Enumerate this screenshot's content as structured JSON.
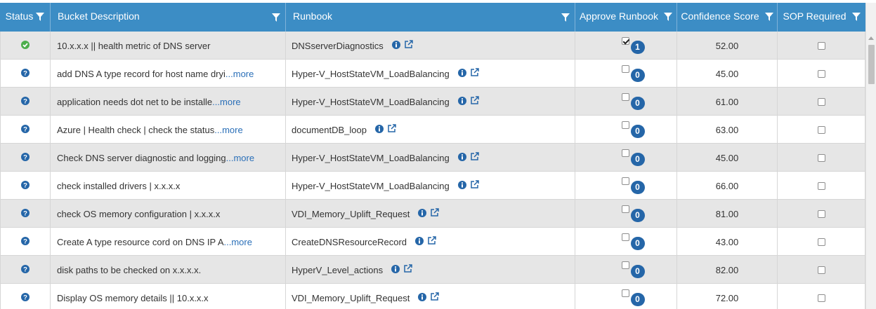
{
  "columns": {
    "status": "Status",
    "bucket": "Bucket Description",
    "runbook": "Runbook",
    "approve": "Approve Runbook",
    "confidence": "Confidence Score",
    "sop": "SOP Required"
  },
  "colors": {
    "header": "#3c8dc5",
    "ok": "#4cae4c",
    "info": "#2566a8",
    "link": "#2a6fb8",
    "row_alt": "#e6e6e6"
  },
  "rows": [
    {
      "status_icon": "check-circle-icon",
      "desc": "10.x.x.x || health metric of DNS server",
      "more": "",
      "runbook": "DNSserverDiagnostics",
      "approved": true,
      "count": "1",
      "score": "52.00",
      "sop": false
    },
    {
      "status_icon": "question-circle-icon",
      "desc": "add DNS A type record for host name dryi",
      "more": "...more",
      "runbook": "Hyper-V_HostStateVM_LoadBalancing",
      "approved": false,
      "count": "0",
      "score": "45.00",
      "sop": false
    },
    {
      "status_icon": "question-circle-icon",
      "desc": "application needs dot net to be installe",
      "more": "...more",
      "runbook": "Hyper-V_HostStateVM_LoadBalancing",
      "approved": false,
      "count": "0",
      "score": "61.00",
      "sop": false
    },
    {
      "status_icon": "question-circle-icon",
      "desc": "Azure | Health check | check the status ",
      "more": "...more",
      "runbook": "documentDB_loop",
      "approved": false,
      "count": "0",
      "score": "63.00",
      "sop": false
    },
    {
      "status_icon": "question-circle-icon",
      "desc": "Check DNS server diagnostic and logging ",
      "more": "...more",
      "runbook": "Hyper-V_HostStateVM_LoadBalancing",
      "approved": false,
      "count": "0",
      "score": "45.00",
      "sop": false
    },
    {
      "status_icon": "question-circle-icon",
      "desc": "check installed drivers | x.x.x.x",
      "more": "",
      "runbook": "Hyper-V_HostStateVM_LoadBalancing",
      "approved": false,
      "count": "0",
      "score": "66.00",
      "sop": false
    },
    {
      "status_icon": "question-circle-icon",
      "desc": "check OS memory configuration | x.x.x.x",
      "more": "",
      "runbook": "VDI_Memory_Uplift_Request",
      "approved": false,
      "count": "0",
      "score": "81.00",
      "sop": false
    },
    {
      "status_icon": "question-circle-icon",
      "desc": "Create A type resource cord on DNS IP A",
      "more": "...more",
      "runbook": "CreateDNSResourceRecord",
      "approved": false,
      "count": "0",
      "score": "43.00",
      "sop": false
    },
    {
      "status_icon": "question-circle-icon",
      "desc": "disk paths to be checked on x.x.x.x.",
      "more": "",
      "runbook": "HyperV_Level_actions",
      "approved": false,
      "count": "0",
      "score": "82.00",
      "sop": false
    },
    {
      "status_icon": "question-circle-icon",
      "desc": "Display OS memory details || 10.x.x.x",
      "more": "",
      "runbook": "VDI_Memory_Uplift_Request",
      "approved": false,
      "count": "0",
      "score": "72.00",
      "sop": false
    }
  ]
}
